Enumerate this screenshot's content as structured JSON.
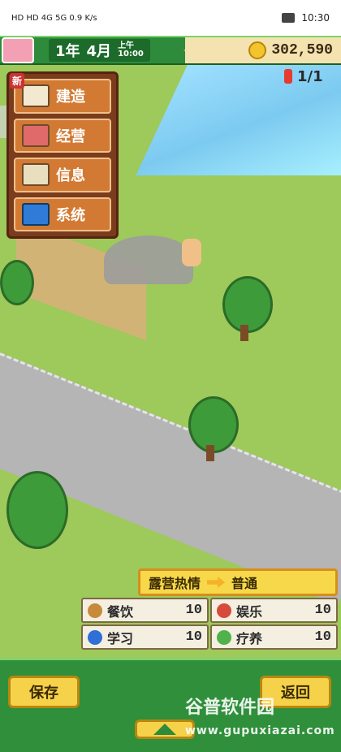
{
  "status_bar": {
    "left_text": "HD HD 4G 5G 0.9 K/s",
    "time": "10:30"
  },
  "hud": {
    "year": "1年",
    "month": "4月",
    "period": "上午",
    "clock": "10:00",
    "money": "302,590",
    "camp_count": "1/1"
  },
  "menu": {
    "new_badge": "新",
    "items": [
      {
        "label": "建造"
      },
      {
        "label": "经营"
      },
      {
        "label": "信息"
      },
      {
        "label": "系统"
      }
    ]
  },
  "stats": {
    "fever_label": "露营热情",
    "fever_value": "普通",
    "items": [
      {
        "label": "餐饮",
        "value": "10"
      },
      {
        "label": "娱乐",
        "value": "10"
      },
      {
        "label": "学习",
        "value": "10"
      },
      {
        "label": "疗养",
        "value": "10"
      }
    ]
  },
  "buttons": {
    "save": "保存",
    "back": "返回"
  },
  "watermark": {
    "line1": "谷普软件园",
    "line2": "www.gupuxiazai.com"
  }
}
